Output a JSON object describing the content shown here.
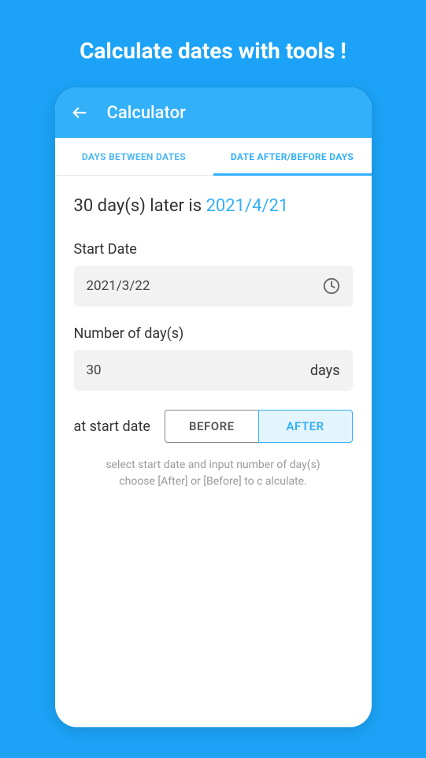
{
  "promo": {
    "title": "Calculate dates with tools !"
  },
  "appbar": {
    "title": "Calculator"
  },
  "tabs": {
    "days_between": "DAYS BETWEEN DATES",
    "date_after_before": "DATE AFTER/BEFORE DAYS"
  },
  "result": {
    "prefix": "30 day(s) later is ",
    "date": "2021/4/21"
  },
  "fields": {
    "start_date_label": "Start Date",
    "start_date_value": "2021/3/22",
    "days_label": "Number of day(s)",
    "days_value": "30",
    "days_suffix": "days"
  },
  "toggle": {
    "label": "at start date",
    "before": "BEFORE",
    "after": "AFTER"
  },
  "help": {
    "line1": "select start date and input number of day(s)",
    "line2": "choose [After] or [Before] to c alculate."
  }
}
